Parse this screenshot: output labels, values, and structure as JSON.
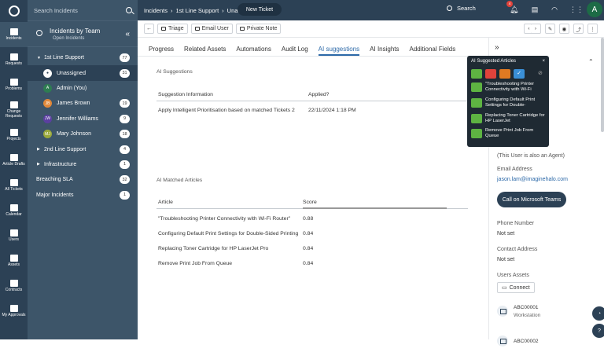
{
  "rail": {
    "items": [
      {
        "label": "Incidents",
        "active": true
      },
      {
        "label": "Requests"
      },
      {
        "label": "Problems"
      },
      {
        "label": "Change Requests"
      },
      {
        "label": "Projects"
      },
      {
        "label": "Article Drafts"
      },
      {
        "label": "All Tickets"
      },
      {
        "label": "Calendar"
      },
      {
        "label": "Users"
      },
      {
        "label": "Assets"
      },
      {
        "label": "Contracts"
      },
      {
        "label": "My Approvals"
      }
    ]
  },
  "sidebar": {
    "search_placeholder": "Search Incidents",
    "team_title": "Incidents by Team",
    "team_sub": "Open Incidents",
    "items": [
      {
        "label": "1st Line Support",
        "count": "77"
      },
      {
        "label": "Unassigned",
        "count": "31"
      },
      {
        "label": "Admin (You)",
        "count": ""
      },
      {
        "label": "James Brown",
        "count": "19"
      },
      {
        "label": "Jennifer Williams",
        "count": "9"
      },
      {
        "label": "Mary Johnson",
        "count": "18"
      },
      {
        "label": "2nd Line Support",
        "count": "4"
      },
      {
        "label": "Infrastructure",
        "count": "1"
      },
      {
        "label": "Breaching SLA",
        "count": "32"
      },
      {
        "label": "Major Incidents",
        "count": "1"
      }
    ],
    "avatars": [
      "A",
      "JB",
      "JW",
      "MJ"
    ],
    "avatar_colors": [
      "#2e7d52",
      "#e0883a",
      "#5b3fa0",
      "#9aa83a"
    ]
  },
  "topbar": {
    "breadcrumb": [
      "Incidents",
      "1st Line Support",
      "Unassigned",
      "4826"
    ],
    "new_ticket": "New Ticket",
    "search": "Search",
    "notif_count": "4",
    "avatar": "A"
  },
  "toolbar": {
    "triage": "Triage",
    "email_user": "Email User",
    "private_note": "Private Note"
  },
  "tabs": [
    "Progress",
    "Related Assets",
    "Automations",
    "Audit Log",
    "AI suggestions",
    "AI Insights",
    "Additional Fields"
  ],
  "ai_suggestions": {
    "section_title": "AI Suggestions",
    "headers": [
      "Suggestion Information",
      "Applied?"
    ],
    "rows": [
      [
        "Apply Intelligent Prioritisation based on matched Tickets 2",
        "22/11/2024 1:18 PM"
      ]
    ]
  },
  "ai_matched": {
    "section_title": "AI Matched Articles",
    "headers": [
      "Article",
      "Score"
    ],
    "rows": [
      [
        "\"Troubleshooting Printer Connectivity with Wi-Fi Router\"",
        "0.88"
      ],
      [
        "Configuring Default Print Settings for Double-Sided Printing",
        "0.84"
      ],
      [
        "Replacing Toner Cartridge for HP LaserJet Pro",
        "0.84"
      ],
      [
        "Remove Print Job From Queue",
        "0.84"
      ]
    ]
  },
  "popup": {
    "title": "AI Suggested Articles",
    "articles": [
      "\"Troubleshooting Printer Connectivity with Wi-Fi",
      "Configuring Default Print Settings for Double-",
      "Replacing Toner Cartridge for HP LaserJet",
      "Remove Print Job From Queue"
    ],
    "icon_colors": [
      "#5eb342",
      "#e0433b",
      "#e07a22",
      "#3a8fd6"
    ]
  },
  "right_panel": {
    "agent_note": "(This User is also an Agent)",
    "email_label": "Email Address",
    "email_value": "jason.lam@imaginehalo.com",
    "teams_button": "Call on Microsoft Teams",
    "phone_label": "Phone Number",
    "phone_value": "Not set",
    "contact_label": "Contact Address",
    "contact_value": "Not set",
    "assets_label": "Users Assets",
    "connect": "Connect",
    "assets": [
      {
        "id": "ABC00001",
        "type": "Workstation"
      },
      {
        "id": "ABC00002",
        "type": ""
      }
    ],
    "accent": "#2c4155"
  }
}
